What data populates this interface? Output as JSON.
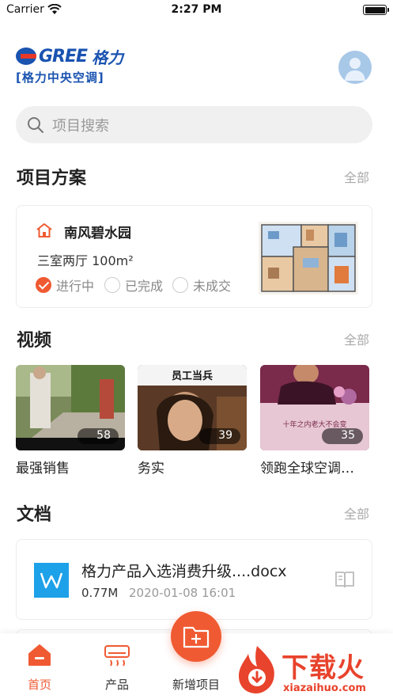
{
  "status_bar": {
    "carrier": "Carrier",
    "time": "2:27 PM"
  },
  "header": {
    "logo_word": "GREE",
    "logo_cn": "格力",
    "logo_sub": "[格力中央空调]",
    "avatar_icon": "user-avatar-icon"
  },
  "search": {
    "placeholder": "项目搜索",
    "icon": "search-icon"
  },
  "projects": {
    "title": "项目方案",
    "more": "全部",
    "card": {
      "name": "南风碧水园",
      "spec": "三室两厅  100m²",
      "statuses": [
        {
          "label": "进行中",
          "checked": true
        },
        {
          "label": "已完成",
          "checked": false
        },
        {
          "label": "未成交",
          "checked": false
        }
      ]
    }
  },
  "videos": {
    "title": "视频",
    "more": "全部",
    "items": [
      {
        "title": "最强销售",
        "count": "58"
      },
      {
        "title": "务实",
        "count": "39",
        "caption": "员工当兵"
      },
      {
        "title": "领跑全球空调…",
        "count": "35",
        "caption": "十年之内老大不会变"
      }
    ]
  },
  "documents": {
    "title": "文档",
    "more": "全部",
    "items": [
      {
        "name": "格力产品入选消费升级....docx",
        "size": "0.77M",
        "time": "2020-01-08 16:01"
      }
    ]
  },
  "tab_bar": {
    "tabs": [
      {
        "label": "首页",
        "icon": "home-icon",
        "active": true
      },
      {
        "label": "产品",
        "icon": "air-conditioner-icon",
        "active": false
      },
      {
        "label": "新增项目",
        "icon": "add-folder-icon",
        "active": false
      }
    ]
  },
  "watermark": {
    "text": "下载火",
    "url": "xiazaihuo.com"
  },
  "colors": {
    "accent": "#f05a32",
    "brand_blue": "#1a53b0",
    "doc_blue": "#1da1e8"
  }
}
